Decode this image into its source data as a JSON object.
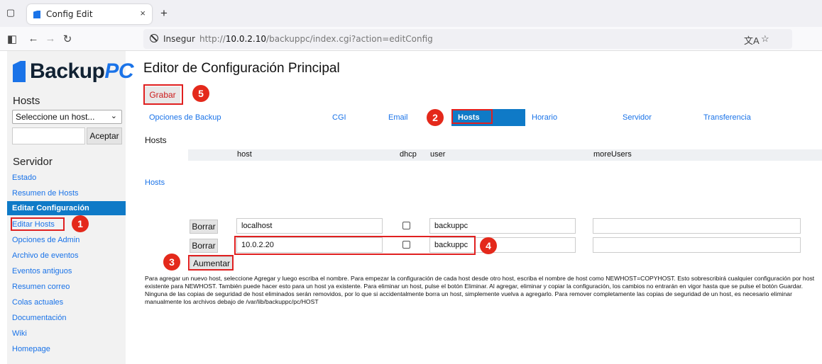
{
  "browser": {
    "tab_title": "Config Edit",
    "tab_close": "×",
    "new_tab": "+",
    "insecure_label": "Insegur",
    "url_prefix": "http://",
    "url_host": "10.0.2.10",
    "url_path": "/backuppc/index.cgi?action=editConfig",
    "translate_glyph": "文A",
    "star_glyph": "☆"
  },
  "sidebar": {
    "logo_backup": "Backup",
    "logo_pc": "PC",
    "hosts_heading": "Hosts",
    "host_select": "Seleccione un host...",
    "accept_button": "Aceptar",
    "server_heading": "Servidor",
    "links": [
      {
        "label": "Estado"
      },
      {
        "label": "Resumen de Hosts"
      },
      {
        "label": "Editar Configuración"
      },
      {
        "label": "Editar Hosts"
      },
      {
        "label": "Opciones de Admin"
      },
      {
        "label": "Archivo de eventos"
      },
      {
        "label": "Eventos antiguos"
      },
      {
        "label": "Resumen correo"
      },
      {
        "label": "Colas actuales"
      },
      {
        "label": "Documentación"
      },
      {
        "label": "Wiki"
      },
      {
        "label": "Homepage"
      }
    ]
  },
  "main": {
    "title": "Editor de Configuración Principal",
    "save_button": "Grabar",
    "tabs": [
      {
        "label": "Opciones de Backup"
      },
      {
        "label": "CGI"
      },
      {
        "label": "Email"
      },
      {
        "label": "Hosts"
      },
      {
        "label": "Horario"
      },
      {
        "label": "Servidor"
      },
      {
        "label": "Transferencia"
      }
    ],
    "section_label": "Hosts",
    "table_label": "Hosts",
    "columns": {
      "host": "host",
      "dhcp": "dhcp",
      "user": "user",
      "moreUsers": "moreUsers"
    },
    "rows": [
      {
        "delete": "Borrar",
        "host": "localhost",
        "dhcp": false,
        "user": "backuppc",
        "moreUsers": ""
      },
      {
        "delete": "Borrar",
        "host": "10.0.2.20",
        "dhcp": false,
        "user": "backuppc",
        "moreUsers": ""
      }
    ],
    "add_button": "Aumentar",
    "help_text": "Para agregar un nuevo host, seleccione Agregar y luego escriba el nombre. Para empezar la configuración de cada host desde otro host, escriba el nombre de host como NEWHOST=COPYHOST. Esto sobrescribirá cualquier configuración por host existente para NEWHOST. También puede hacer esto para un host ya existente. Para eliminar un host, pulse el botón Eliminar. Al agregar, eliminar y copiar la configuración, los cambios no entrarán en vigor hasta que se pulse el botón Guardar. Ninguna de las copias de seguridad de host eliminados serán removidos, por lo que si accidentalmente borra un host, simplemente vuelva a agregarlo. Para remover completamente las copias de seguridad de un host, es necesario eliminar manualmente los archivos debajo de /var/lib/backuppc/pc/HOST"
  },
  "annotations": {
    "step1": "1",
    "step2": "2",
    "step3": "3",
    "step4": "4",
    "step5": "5"
  },
  "colors": {
    "accent": "#1a73e8",
    "active_bg": "#0f7ac7",
    "annotation_red": "#e4291b"
  }
}
